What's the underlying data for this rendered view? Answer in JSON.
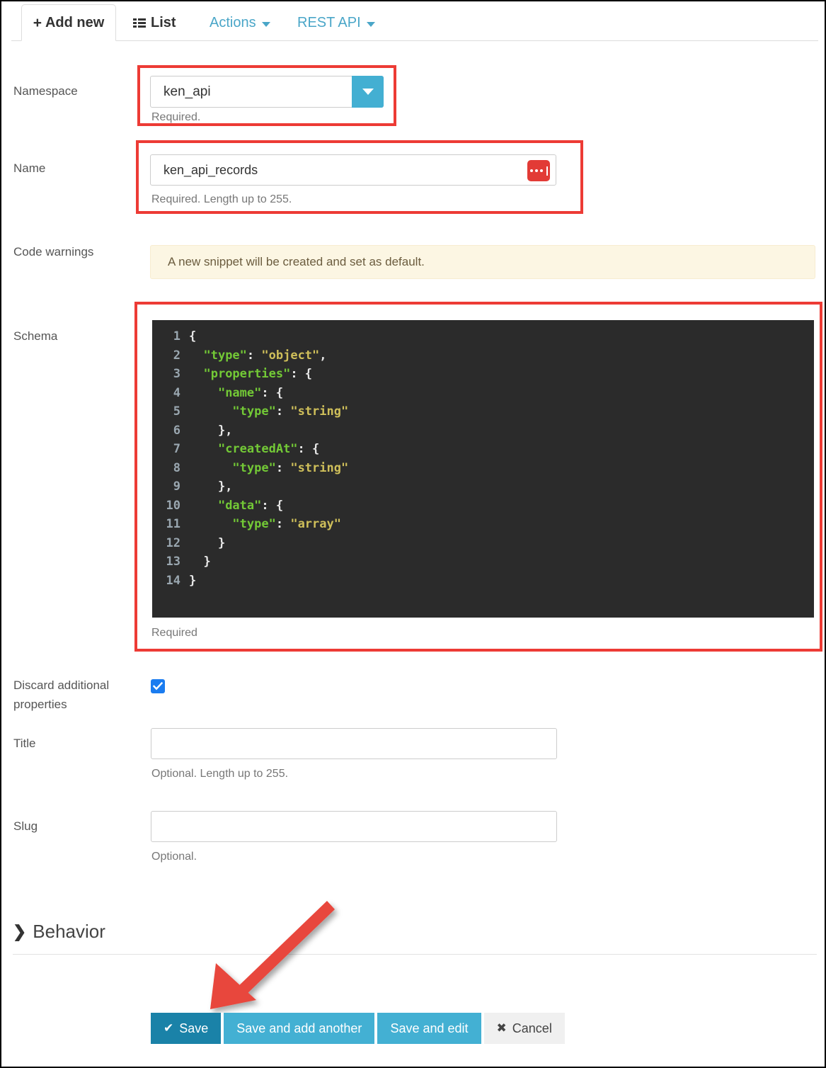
{
  "tabs": [
    {
      "label": "Add new",
      "icon": "plus-icon",
      "active": true
    },
    {
      "label": "List",
      "icon": "list-icon",
      "active": false
    },
    {
      "label": "Actions",
      "icon": "chevron-down-icon",
      "active": false
    },
    {
      "label": "REST API",
      "icon": "chevron-down-icon",
      "active": false
    }
  ],
  "form": {
    "namespace": {
      "label": "Namespace",
      "value": "ken_api",
      "help": "Required."
    },
    "name": {
      "label": "Name",
      "value": "ken_api_records",
      "help": "Required. Length up to 255.",
      "button_icon": "ellipsis-icon"
    },
    "code_warnings": {
      "label": "Code warnings",
      "message": "A new snippet will be created and set as default."
    },
    "schema": {
      "label": "Schema",
      "help": "Required",
      "lines": [
        {
          "n": "1",
          "code": "{"
        },
        {
          "n": "2",
          "code": "  \"type\": \"object\","
        },
        {
          "n": "3",
          "code": "  \"properties\": {"
        },
        {
          "n": "4",
          "code": "    \"name\": {"
        },
        {
          "n": "5",
          "code": "      \"type\": \"string\""
        },
        {
          "n": "6",
          "code": "    },"
        },
        {
          "n": "7",
          "code": "    \"createdAt\": {"
        },
        {
          "n": "8",
          "code": "      \"type\": \"string\""
        },
        {
          "n": "9",
          "code": "    },"
        },
        {
          "n": "10",
          "code": "    \"data\": {"
        },
        {
          "n": "11",
          "code": "      \"type\": \"array\""
        },
        {
          "n": "12",
          "code": "    }"
        },
        {
          "n": "13",
          "code": "  }"
        },
        {
          "n": "14",
          "code": "}"
        }
      ]
    },
    "discard_additional_properties": {
      "label": "Discard additional properties",
      "checked": true
    },
    "title": {
      "label": "Title",
      "value": "",
      "placeholder": "",
      "help": "Optional. Length up to 255."
    },
    "slug": {
      "label": "Slug",
      "value": "",
      "placeholder": "",
      "help": "Optional."
    }
  },
  "behavior": {
    "label": "Behavior",
    "chevron": "❯"
  },
  "buttons": {
    "save": "Save",
    "save_add_another": "Save and add another",
    "save_and_edit": "Save and edit",
    "cancel": "Cancel",
    "save_glyph": "✔",
    "cancel_glyph": "✖"
  },
  "colors": {
    "accent": "#43b0d3",
    "save": "#1a82a8",
    "annotation": "#ed3b35",
    "warning_bg": "#fcf6e3",
    "editor_bg": "#2b2b2b",
    "code_key": "#73c936",
    "code_string": "#cfbf5a",
    "checkbox": "#1a7cf0"
  }
}
